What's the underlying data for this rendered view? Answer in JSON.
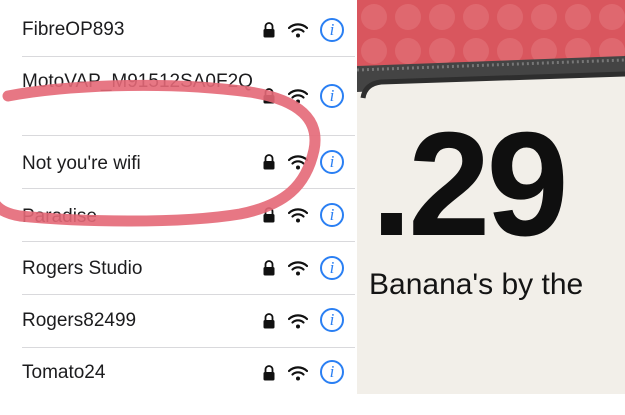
{
  "wifi_list": {
    "networks": [
      {
        "name": "FibreOP893",
        "secured": true,
        "info_glyph": "i"
      },
      {
        "name": "MotoVAP_M91512SA0F2Q",
        "secured": true,
        "info_glyph": "i"
      },
      {
        "name": "Not you're wifi",
        "secured": true,
        "info_glyph": "i"
      },
      {
        "name": "Paradise",
        "secured": true,
        "info_glyph": "i"
      },
      {
        "name": "Rogers Studio",
        "secured": true,
        "info_glyph": "i"
      },
      {
        "name": "Rogers82499",
        "secured": true,
        "info_glyph": "i"
      },
      {
        "name": "Tomato24",
        "secured": true,
        "info_glyph": "i"
      }
    ],
    "icons": {
      "lock": "lock-icon",
      "signal": "wifi-signal-icon",
      "info": "info-icon"
    },
    "colors": {
      "info_accent": "#2a7ff3",
      "highlight_circle": "#e46877",
      "text": "#1c1c1e"
    }
  },
  "price_sign": {
    "price": ".29",
    "caption": "Banana's by the",
    "colors": {
      "background_top": "#d9565e",
      "sign_face": "#f2efe9"
    }
  }
}
